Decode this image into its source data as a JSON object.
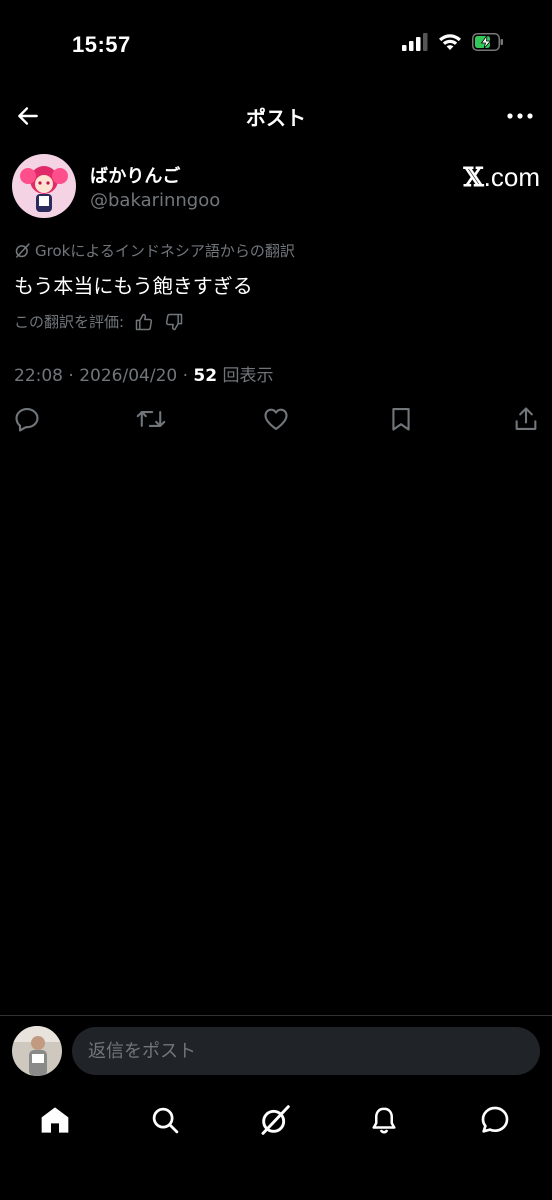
{
  "status_bar": {
    "time": "15:57"
  },
  "header": {
    "title": "ポスト"
  },
  "author": {
    "display_name": "ばかりんご",
    "handle": "@bakarinngoo",
    "site_badge": ".com",
    "site_badge_x": "𝕏"
  },
  "post": {
    "translation_note": "Grokによるインドネシア語からの翻訳",
    "text": "もう本当にもう飽きすぎる",
    "rate_label": "この翻訳を評価:",
    "time": "22:08",
    "date": "2026/04/20",
    "views_count": "52",
    "views_label": "回表示"
  },
  "reply": {
    "placeholder": "返信をポスト"
  },
  "icons": {
    "back": "arrow-left-icon",
    "more": "more-dots-icon",
    "reply": "reply-icon",
    "repost": "repost-icon",
    "like": "heart-icon",
    "bookmark": "bookmark-icon",
    "share": "share-icon",
    "home": "home-icon",
    "search": "search-icon",
    "grok": "grok-icon",
    "notifications": "bell-icon",
    "messages": "message-icon"
  },
  "colors": {
    "background": "#000000",
    "secondary_text": "#71767b",
    "battery_green": "#34c759",
    "input_bg": "#202327"
  }
}
